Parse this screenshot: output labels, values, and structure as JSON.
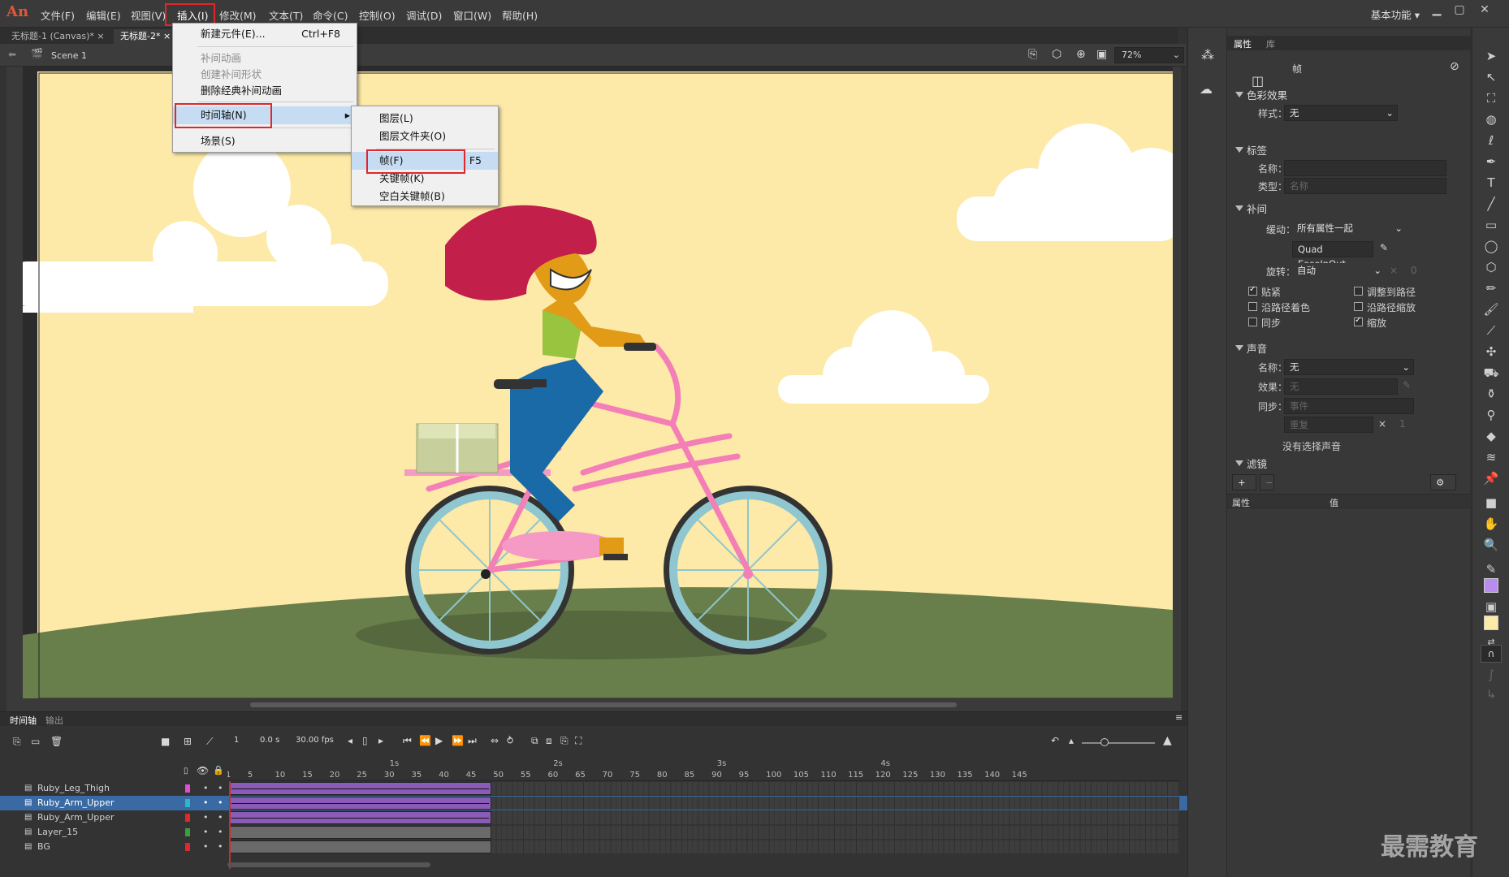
{
  "app": {
    "logo": "An"
  },
  "menubar": {
    "items": [
      "文件(F)",
      "编辑(E)",
      "视图(V)",
      "插入(I)",
      "修改(M)",
      "文本(T)",
      "命令(C)",
      "控制(O)",
      "调试(D)",
      "窗口(W)",
      "帮助(H)"
    ],
    "workspace": "基本功能",
    "workspace_arrow": "▾"
  },
  "tabs": [
    {
      "label": "无标题-1 (Canvas)*",
      "close": "×"
    },
    {
      "label": "无标题-2*",
      "close": "×"
    }
  ],
  "editbar": {
    "scene": "Scene 1",
    "zoom": "72%"
  },
  "insert_menu": {
    "items": [
      {
        "label": "新建元件(E)...",
        "shortcut": "Ctrl+F8"
      },
      {
        "label": "补间动画"
      },
      {
        "label": "创建补间形状"
      },
      {
        "label": "删除经典补间动画"
      },
      {
        "label": "时间轴(N)",
        "arrow": "▸"
      },
      {
        "label": "场景(S)"
      }
    ]
  },
  "timeline_submenu": {
    "items": [
      {
        "label": "图层(L)"
      },
      {
        "label": "图层文件夹(O)"
      },
      {
        "label": "帧(F)",
        "shortcut": "F5"
      },
      {
        "label": "关键帧(K)"
      },
      {
        "label": "空白关键帧(B)"
      }
    ]
  },
  "properties": {
    "tabs": [
      "属性",
      "库"
    ],
    "frame_label": "帧",
    "color_effect": {
      "title": "色彩效果",
      "style_label": "样式：",
      "style_value": "无"
    },
    "label": {
      "title": "标签",
      "name_label": "名称：",
      "type_label": "类型：",
      "type_value": "名称"
    },
    "tween": {
      "title": "补间",
      "ease_label": "缓动：",
      "ease_value": "所有属性一起",
      "ease_preset": "Quad EaseInOut",
      "rotate_label": "旋转：",
      "rotate_value": "自动",
      "rotate_x": "×",
      "rotate_count": "0",
      "checks": [
        {
          "label": "贴紧",
          "checked": true
        },
        {
          "label": "调整到路径",
          "checked": false
        },
        {
          "label": "沿路径着色",
          "checked": false
        },
        {
          "label": "沿路径缩放",
          "checked": false
        },
        {
          "label": "同步",
          "checked": false
        },
        {
          "label": "缩放",
          "checked": true
        }
      ]
    },
    "sound": {
      "title": "声音",
      "name_label": "名称：",
      "name_value": "无",
      "effect_label": "效果：",
      "effect_value": "无",
      "sync_label": "同步：",
      "sync_value": "事件",
      "repeat_value": "重复",
      "repeat_x": "×",
      "repeat_count": "1",
      "no_sound": "没有选择声音"
    },
    "filter": {
      "title": "滤镜",
      "col_prop": "属性",
      "col_value": "值",
      "add": "+",
      "remove": "−",
      "gear": "⚙"
    }
  },
  "timeline": {
    "tabs": [
      "时间轴",
      "输出"
    ],
    "frame": "1",
    "time": "0.0 s",
    "fps": "30.00 fps",
    "ruler_numbers": [
      "1",
      "5",
      "10",
      "15",
      "20",
      "25",
      "30",
      "35",
      "40",
      "45",
      "50",
      "55",
      "60",
      "65",
      "70",
      "75",
      "80",
      "85",
      "90",
      "95",
      "100",
      "105",
      "110",
      "115",
      "120",
      "125",
      "130",
      "135",
      "140",
      "145"
    ],
    "ruler_seconds": [
      "1s",
      "2s",
      "3s",
      "4s"
    ],
    "layers": [
      {
        "name": "Ruby_Leg_Thigh",
        "color": "#e04fd3",
        "selected": false,
        "tween": true
      },
      {
        "name": "Ruby_Arm_Upper",
        "color": "#2fb7c7",
        "selected": true,
        "tween": true
      },
      {
        "name": "Ruby_Arm_Upper",
        "color": "#e0272c",
        "selected": false,
        "tween": true
      },
      {
        "name": "Layer_15",
        "color": "#3aa03a",
        "selected": false,
        "tween": false
      },
      {
        "name": "BG",
        "color": "#e0272c",
        "selected": false,
        "tween": false
      }
    ]
  },
  "watermark": "最需教育",
  "colors": {
    "accent": "#e0272c",
    "selection": "#3a6aa3",
    "tween": "#8a5cb8",
    "stroke_swatch": "#b98df0",
    "fill_swatch": "#fde9a8"
  }
}
